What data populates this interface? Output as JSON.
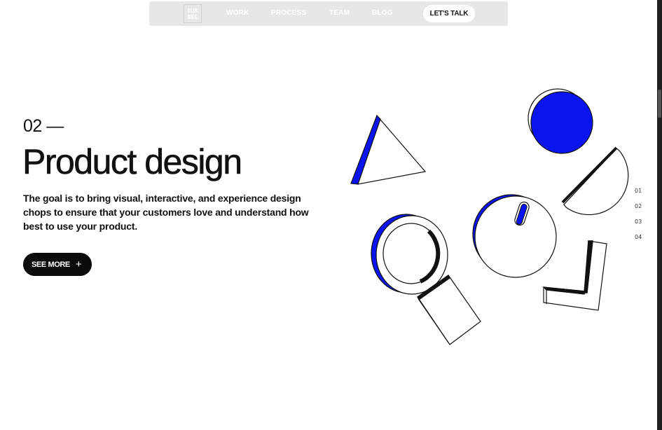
{
  "nav": {
    "logo_lines": [
      "DUR",
      "DEC"
    ],
    "links": [
      "WORK",
      "PROCESS",
      "TEAM",
      "BLOG"
    ],
    "cta_label": "LET'S TALK"
  },
  "hero": {
    "section_number": "02 —",
    "title": "Product design",
    "description": "The goal is to bring visual, interactive, and experience design chops to ensure that your customers love and understand how best to use your product.",
    "see_more_label": "SEE MORE",
    "see_more_icon": "plus-icon"
  },
  "illustration": {
    "shapes": [
      "triangle",
      "blue-circle",
      "half-circle",
      "ring",
      "circle-with-slot",
      "rectangle",
      "l-shape"
    ],
    "accent_color": "#0a14f0"
  },
  "slides": [
    "01",
    "02",
    "03",
    "04"
  ],
  "colors": {
    "accent": "#0a14f0",
    "text": "#111111",
    "nav_bg": "#e7e7e7",
    "button_bg": "#0b0b0b"
  }
}
